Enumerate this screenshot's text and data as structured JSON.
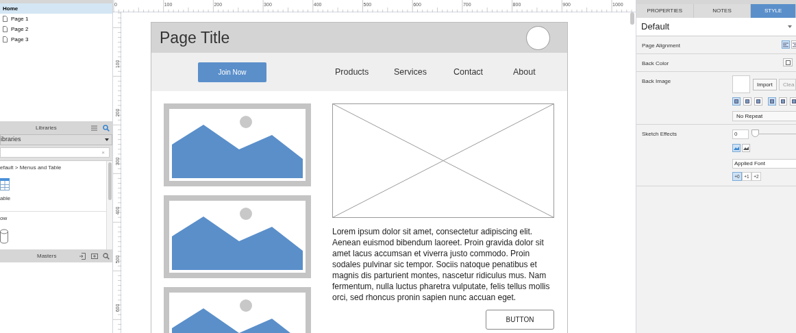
{
  "pages_panel": {
    "items": [
      {
        "label": "Home",
        "kind": "home",
        "selected": true
      },
      {
        "label": "Page 1",
        "kind": "page",
        "selected": false
      },
      {
        "label": "Page 2",
        "kind": "page",
        "selected": false
      },
      {
        "label": "Page 3",
        "kind": "page",
        "selected": false
      }
    ]
  },
  "libraries_panel": {
    "title": "Libraries",
    "dropdown": "ibraries",
    "search_clear": "×",
    "sections": [
      {
        "heading": "efault > Menus and Table",
        "items": [
          {
            "label": "able",
            "kind": "table"
          }
        ]
      },
      {
        "heading": "ow",
        "items": [
          {
            "kind": "cylinder"
          }
        ]
      }
    ]
  },
  "masters_panel": {
    "title": "Masters"
  },
  "rulers": {
    "horizontal": [
      "0",
      "100",
      "200",
      "300",
      "400",
      "500",
      "600",
      "700",
      "800",
      "900",
      "1000"
    ],
    "vertical": [
      "100",
      "200",
      "300",
      "400",
      "500",
      "600"
    ]
  },
  "mockup": {
    "title": "Page Title",
    "nav_button": "Join Now",
    "nav_links": [
      "Products",
      "Services",
      "Contact",
      "About"
    ],
    "paragraph": "Lorem ipsum dolor sit amet, consectetur adipiscing elit. Aenean euismod bibendum laoreet. Proin gravida dolor sit amet lacus accumsan et viverra justo commodo. Proin sodales pulvinar sic tempor. Sociis natoque penatibus et magnis dis parturient montes, nascetur ridiculus mus. Nam fermentum, nulla luctus pharetra vulputate, felis tellus mollis orci, sed rhoncus pronin sapien nunc accuan eget.",
    "button": "BUTTON"
  },
  "inspector": {
    "tabs": [
      {
        "label": "PROPERTIES",
        "selected": false
      },
      {
        "label": "NOTES",
        "selected": false
      },
      {
        "label": "STYLE",
        "selected": true
      }
    ],
    "style_name": "Default",
    "page_alignment": {
      "label": "Page Alignment",
      "left_selected": true
    },
    "back_color": {
      "label": "Back Color"
    },
    "back_image": {
      "label": "Back Image",
      "import": "Import",
      "clear": "Clea",
      "positions": [
        {
          "selected": true
        },
        {
          "selected": false
        },
        {
          "selected": false
        },
        {
          "selected": true
        },
        {
          "selected": false
        },
        {
          "selected": false
        }
      ],
      "repeat": "No Repeat"
    },
    "sketch_effects": {
      "label": "Sketch Effects",
      "value": "0",
      "level": 0,
      "modes": [
        {
          "selected": true
        },
        {
          "selected": false
        }
      ],
      "font": "Applied Font",
      "sizes": [
        {
          "label": "+0",
          "selected": true
        },
        {
          "label": "+1",
          "selected": false
        },
        {
          "label": "+2",
          "selected": false
        }
      ]
    }
  }
}
